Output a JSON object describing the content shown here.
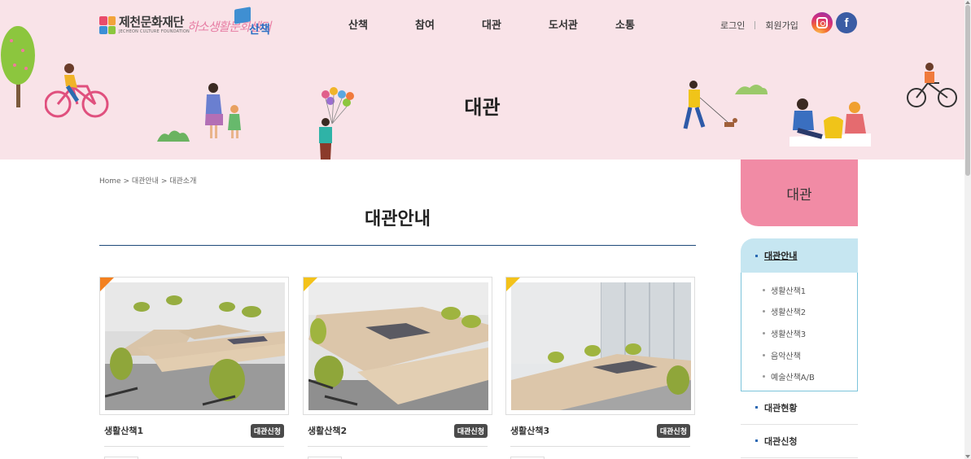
{
  "header": {
    "org_name": "제천문화재단",
    "org_name_en": "JECHEON CULTURE FOUNDATION",
    "center_name": "하소생활문화센터",
    "center_sub": "산책",
    "nav": [
      "산책",
      "참여",
      "대관",
      "도서관",
      "소통"
    ],
    "util": {
      "login": "로그인",
      "join": "회원가입"
    },
    "sns": {
      "instagram_icon": "instagram-icon",
      "facebook_icon": "facebook-icon",
      "facebook_glyph": "f"
    },
    "hero_title": "대관"
  },
  "breadcrumb": "Home > 대관안내 > 대관소개",
  "page_title": "대관안내",
  "cards": [
    {
      "name": "생활산책1",
      "badge": "대관신청",
      "corner_color": "#f3801f"
    },
    {
      "name": "생활산책2",
      "badge": "대관신청",
      "corner_color": "#f3c21a"
    },
    {
      "name": "생활산책3",
      "badge": "대관신청",
      "corner_color": "#f3c21a"
    }
  ],
  "sidebar": {
    "title": "대관",
    "active": "대관안내",
    "sub_items": [
      "생활산책1",
      "생활산책2",
      "생활산책3",
      "음악산책",
      "예술산책A/B"
    ],
    "items": [
      "대관현황",
      "대관신청"
    ]
  },
  "colors": {
    "hero_bg": "#f9e3e8",
    "sidebar_title_bg": "#f18ba5",
    "sidebar_active_bg": "#c6e6f1",
    "title_rule": "#1e4a7a",
    "badge_bg": "#4a4a4a"
  }
}
